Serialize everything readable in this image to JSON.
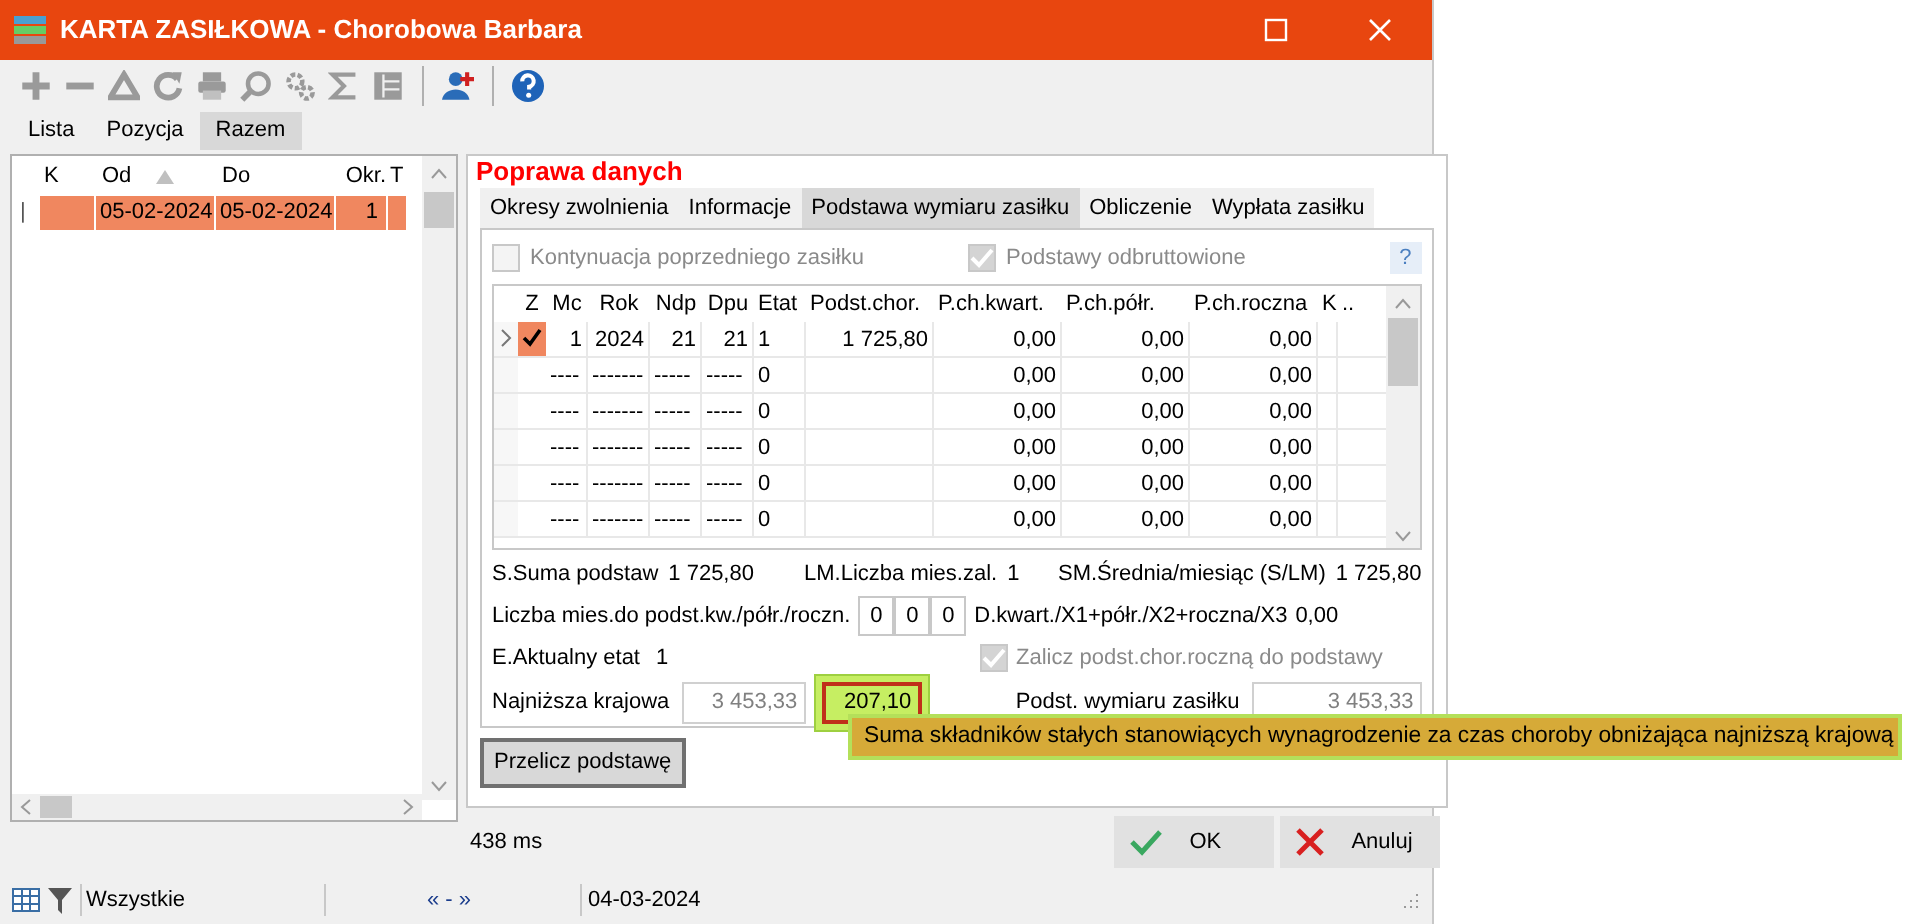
{
  "window": {
    "title": "KARTA ZASIŁKOWA - Chorobowa Barbara"
  },
  "main_tabs": [
    {
      "label": "Lista",
      "selected": false
    },
    {
      "label": "Pozycja",
      "selected": false
    },
    {
      "label": "Razem",
      "selected": true
    }
  ],
  "left_table": {
    "columns": [
      {
        "label": "K",
        "sorted": false
      },
      {
        "label": "Od",
        "sorted": true
      },
      {
        "label": "Do",
        "sorted": false
      },
      {
        "label": "Okr.",
        "sorted": false
      },
      {
        "label": "T",
        "sorted": false
      }
    ],
    "rows": [
      {
        "marker": "|",
        "cells": [
          "",
          "05-02-2024",
          "05-02-2024",
          "1",
          ""
        ],
        "selected": true
      }
    ]
  },
  "section_title": "Poprawa danych",
  "tabs": [
    {
      "label": "Okresy zwolnienia",
      "selected": false
    },
    {
      "label": "Informacje",
      "selected": false
    },
    {
      "label": "Podstawa wymiaru zasiłku",
      "selected": true
    },
    {
      "label": "Obliczenie",
      "selected": false
    },
    {
      "label": "Wypłata zasiłku",
      "selected": false
    }
  ],
  "options": [
    {
      "label": "Kontynuacja poprzedniego zasiłku",
      "checked": false,
      "disabled": true
    },
    {
      "label": "Podstawy odbruttowione",
      "checked": true,
      "disabled": true
    }
  ],
  "help": "?",
  "grid": {
    "check_column": "Z",
    "columns": [
      "Mc",
      "Rok",
      "Ndp",
      "Dpu",
      "Etat",
      "Podst.chor.",
      "P.ch.kwart.",
      "P.ch.półr.",
      "P.ch.roczna",
      "K",
      ".."
    ],
    "rows": [
      {
        "current": true,
        "z_checked": true,
        "cells": [
          "1",
          "2024",
          "21",
          "21",
          "1",
          "1 725,80",
          "0,00",
          "0,00",
          "0,00",
          ""
        ]
      },
      {
        "current": false,
        "z_checked": false,
        "cells": [
          "----",
          "-------",
          "-----",
          "-----",
          "0",
          "",
          "0,00",
          "0,00",
          "0,00",
          ""
        ]
      },
      {
        "current": false,
        "z_checked": false,
        "cells": [
          "----",
          "-------",
          "-----",
          "-----",
          "0",
          "",
          "0,00",
          "0,00",
          "0,00",
          ""
        ]
      },
      {
        "current": false,
        "z_checked": false,
        "cells": [
          "----",
          "-------",
          "-----",
          "-----",
          "0",
          "",
          "0,00",
          "0,00",
          "0,00",
          ""
        ]
      },
      {
        "current": false,
        "z_checked": false,
        "cells": [
          "----",
          "-------",
          "-----",
          "-----",
          "0",
          "",
          "0,00",
          "0,00",
          "0,00",
          ""
        ]
      },
      {
        "current": false,
        "z_checked": false,
        "cells": [
          "----",
          "-------",
          "-----",
          "-----",
          "0",
          "",
          "0,00",
          "0,00",
          "0,00",
          ""
        ]
      }
    ]
  },
  "summary": [
    {
      "label": "S.Suma podstaw",
      "value": "1 725,80"
    },
    {
      "label": "LM.Liczba mies.zal.",
      "value": "1"
    },
    {
      "label": "SM.Średnia/miesiąc (S/LM)",
      "value": "1 725,80"
    }
  ],
  "months": {
    "label": "Liczba mies.do podst.kw./półr./roczn.",
    "values": [
      "0",
      "0",
      "0"
    ],
    "formula": "D.kwart./X1+półr./X2+roczna/X3",
    "formula_value": "0,00"
  },
  "etat": {
    "label": "E.Aktualny etat",
    "value": "1"
  },
  "include_annual": {
    "label": "Zalicz podst.chor.roczną do podstawy",
    "checked": true,
    "disabled": true
  },
  "minimum": {
    "label": "Najniższa krajowa",
    "value": "3 453,33",
    "reduction": "207,10",
    "highlighted": true
  },
  "base": {
    "label": "Podst. wymiaru zasiłku",
    "value": "3 453,33"
  },
  "recalc_button": "Przelicz podstawę",
  "tooltip": "Suma składników stałych stanowiących wynagrodzenie za czas choroby obniżająca najniższą krajową",
  "timing": "438 ms",
  "buttons": [
    {
      "kind": "ok",
      "label": "OK"
    },
    {
      "kind": "cancel",
      "label": "Anuluj"
    }
  ],
  "status_bar": {
    "filter": "Wszystkie",
    "navigation": "« - »",
    "date": "04-03-2024"
  }
}
